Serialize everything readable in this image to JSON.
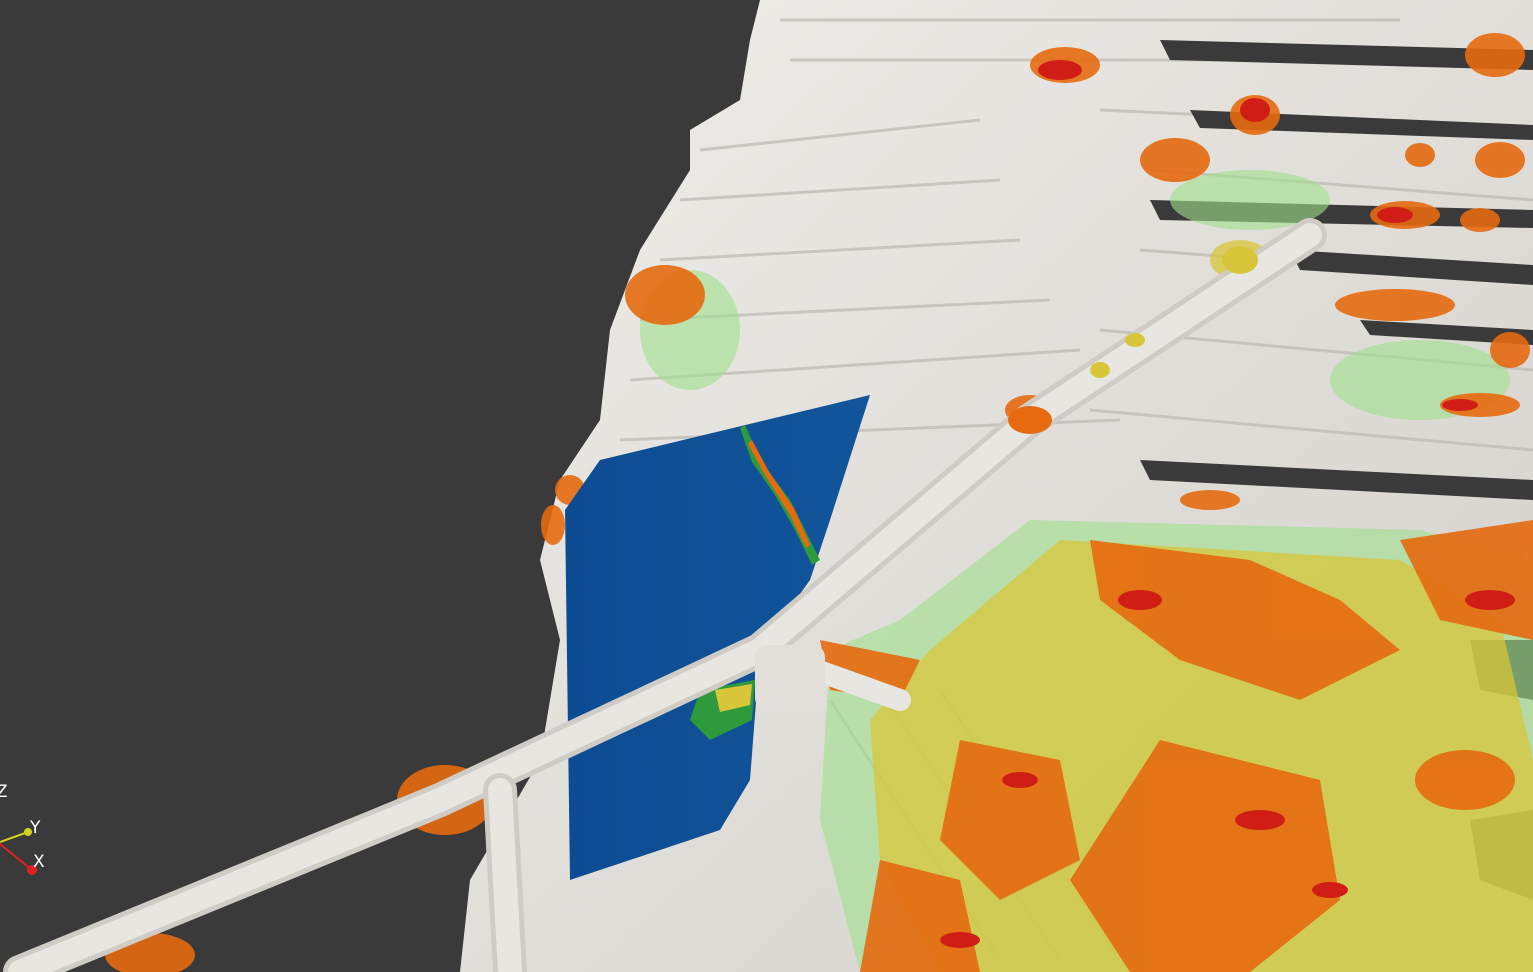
{
  "app": {
    "title": "",
    "background_color": "#3a3a3a"
  },
  "render_view": {
    "description_colors": {
      "surface": "#e6e3de",
      "slice_low": "#0d4c92",
      "slice_mid": "#2f9a3c",
      "field_low": "#9fe08a",
      "field_mid": "#d8c63a",
      "field_high": "#e56a10",
      "field_max": "#d01e16"
    }
  },
  "orientation_axes": {
    "z_label": "Z",
    "y_label": "Y",
    "x_label": "X",
    "x_color": "#e02020",
    "y_color": "#d8d020"
  }
}
